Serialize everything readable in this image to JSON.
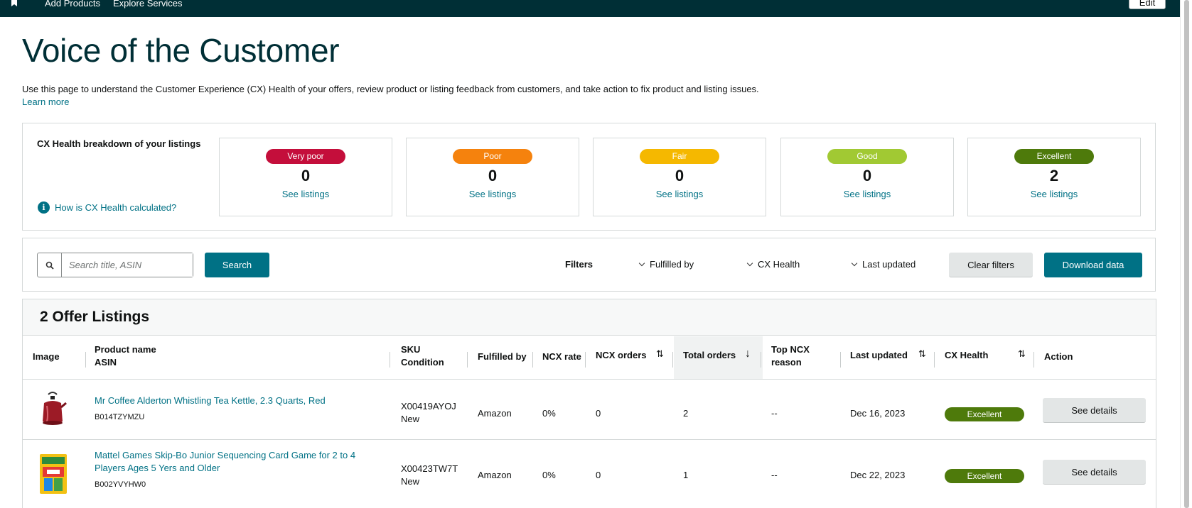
{
  "nav": {
    "links": [
      "Add Products",
      "Explore Services"
    ],
    "edit_label": "Edit"
  },
  "page": {
    "title": "Voice of the Customer",
    "intro": "Use this page to understand the Customer Experience (CX) Health of your offers, review product or listing feedback from customers, and take action to fix product and listing issues.",
    "learn_more": "Learn more"
  },
  "cx_health": {
    "heading": "CX Health breakdown of your listings",
    "help_link": "How is CX Health calculated?",
    "cards": [
      {
        "label": "Very poor",
        "count": "0",
        "link": "See listings",
        "color": "#c40e3b"
      },
      {
        "label": "Poor",
        "count": "0",
        "link": "See listings",
        "color": "#f5820d"
      },
      {
        "label": "Fair",
        "count": "0",
        "link": "See listings",
        "color": "#f5b800"
      },
      {
        "label": "Good",
        "count": "0",
        "link": "See listings",
        "color": "#a1c933"
      },
      {
        "label": "Excellent",
        "count": "2",
        "link": "See listings",
        "color": "#4e7a0b"
      }
    ]
  },
  "filters": {
    "search_placeholder": "Search title, ASIN",
    "search_button": "Search",
    "filters_label": "Filters",
    "dropdowns": [
      "Fulfilled by",
      "CX Health",
      "Last updated"
    ],
    "clear_button": "Clear filters",
    "download_button": "Download data"
  },
  "table": {
    "title": "2 Offer Listings",
    "headers": {
      "image": "Image",
      "product_name": "Product name",
      "asin": "ASIN",
      "sku": "SKU",
      "condition": "Condition",
      "fulfilled_by": "Fulfilled by",
      "ncx_rate": "NCX rate",
      "ncx_orders": "NCX orders",
      "total_orders": "Total orders",
      "top_ncx_1": "Top NCX",
      "top_ncx_2": "reason",
      "last_updated": "Last updated",
      "cx_health": "CX Health",
      "action": "Action"
    },
    "rows": [
      {
        "product_line1": "Mr Coffee Alderton Whistling Tea Kettle, 2.3 Quarts, Red",
        "product_line2": "",
        "asin": "B014TZYMZU",
        "sku": "X00419AYOJ",
        "condition": "New",
        "fulfilled_by": "Amazon",
        "ncx_rate": "0%",
        "ncx_orders": "0",
        "total_orders": "2",
        "top_ncx": "--",
        "last_updated": "Dec 16, 2023",
        "cx_health": "Excellent",
        "action": "See details"
      },
      {
        "product_line1": "Mattel Games Skip-Bo Junior Sequencing Card Game for 2 to 4",
        "product_line2": "Players Ages 5 Yers and Older",
        "asin": "B002YVYHW0",
        "sku": "X00423TW7T",
        "condition": "New",
        "fulfilled_by": "Amazon",
        "ncx_rate": "0%",
        "ncx_orders": "0",
        "total_orders": "1",
        "top_ncx": "--",
        "last_updated": "Dec 22, 2023",
        "cx_health": "Excellent",
        "action": "See details"
      }
    ]
  }
}
